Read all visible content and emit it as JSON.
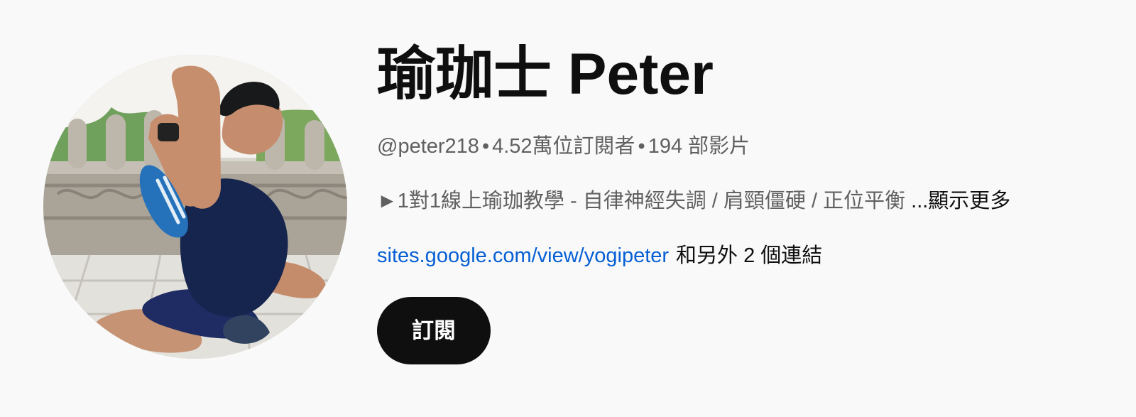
{
  "channel": {
    "title": "瑜珈士 Peter",
    "handle": "@peter218",
    "separator": "•",
    "subscribers": "4.52萬位訂閱者",
    "videos": "194 部影片"
  },
  "description": {
    "text": "►1對1線上瑜珈教學 - 自律神經失調 / 肩頸僵硬 / 正位平衡",
    "more_label": "...顯示更多"
  },
  "links": {
    "primary_link": "sites.google.com/view/yogipeter",
    "more_links_label": "和另外 2 個連結"
  },
  "actions": {
    "subscribe_label": "訂閱"
  },
  "colors": {
    "background": "#f9f9f9",
    "title": "#0f0f0f",
    "secondary_text": "#606060",
    "link": "#065fd4",
    "subscribe_background": "#0f0f0f",
    "subscribe_text": "#ffffff"
  }
}
